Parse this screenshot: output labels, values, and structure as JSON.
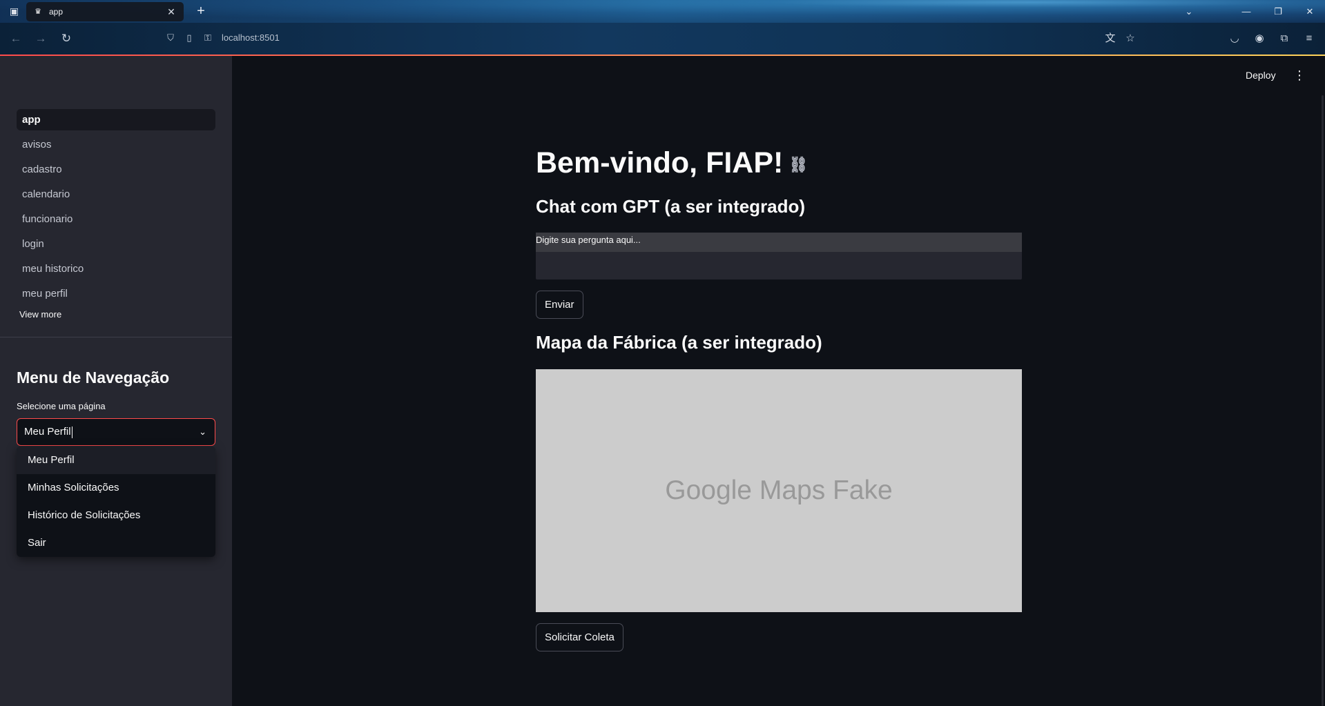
{
  "browser": {
    "tab_title": "app",
    "url": "localhost:8501"
  },
  "sidebar": {
    "pages": [
      {
        "label": "app",
        "active": true
      },
      {
        "label": "avisos"
      },
      {
        "label": "cadastro"
      },
      {
        "label": "calendario"
      },
      {
        "label": "funcionario"
      },
      {
        "label": "login"
      },
      {
        "label": "meu historico"
      },
      {
        "label": "meu perfil"
      }
    ],
    "view_more": "View more",
    "menu_title": "Menu de Navegação",
    "select_label": "Selecione uma página",
    "select_value": "Meu Perfil",
    "options": [
      "Meu Perfil",
      "Minhas Solicitações",
      "Histórico de Solicitações",
      "Sair"
    ]
  },
  "header": {
    "deploy_label": "Deploy"
  },
  "main": {
    "title": "Bem-vindo, FIAP!",
    "chat_heading": "Chat com GPT (a ser integrado)",
    "chat_placeholder": "Digite sua pergunta aqui...",
    "send_label": "Enviar",
    "map_heading": "Mapa da Fábrica (a ser integrado)",
    "map_text": "Google Maps Fake",
    "request_label": "Solicitar Coleta"
  },
  "colors": {
    "accent": "#ff4b4b",
    "background": "#0e1117",
    "sidebar_bg": "#262730",
    "map_bg": "#cccccc"
  }
}
